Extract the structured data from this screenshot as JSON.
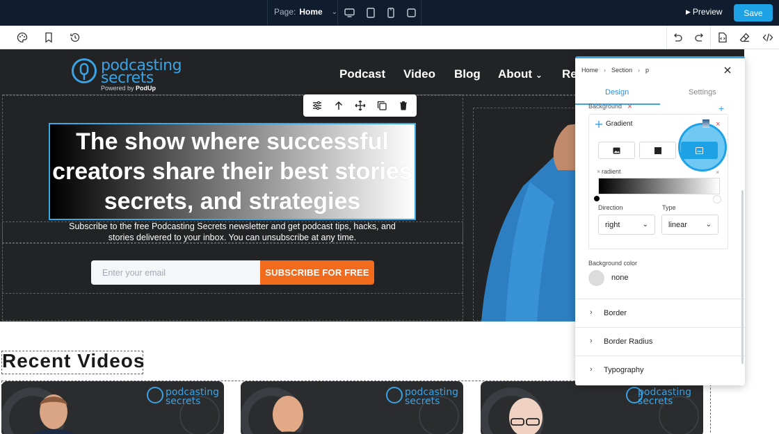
{
  "topbar": {
    "page_label": "Page:",
    "page_name": "Home",
    "preview_label": "Preview",
    "save_label": "Save",
    "colors": {
      "background": "#0f1d2e",
      "save": "#1ea2e6"
    }
  },
  "hero": {
    "logo": {
      "brand_line1": "podcasting",
      "brand_line2": "secrets",
      "powered_by": "Powered by",
      "powered_brand": "PodUp"
    },
    "nav": [
      "Podcast",
      "Video",
      "Blog",
      "About",
      "Re"
    ],
    "headline_line1": "The show where successful",
    "headline_line2": "creators share their best stories",
    "headline_line3": "secrets, and strategies",
    "subtext": "Subscribe to the free Podcasting Secrets newsletter and get podcast tips, hacks, and stories delivered to your inbox. You can unsubscribe at any time.",
    "email_placeholder": "Enter your email",
    "subscribe_label": "SUBSCRIBE FOR FREE",
    "colors": {
      "background": "#222324",
      "subscribe": "#f26a1b",
      "selection": "#39a9e6"
    }
  },
  "recent": {
    "heading": "Recent Videos",
    "cards": [
      {
        "brand_line1": "podcasting",
        "brand_line2": "secrets"
      },
      {
        "brand_line1": "podcasting",
        "brand_line2": "secrets"
      },
      {
        "brand_line1": "podcasting",
        "brand_line2": "secrets"
      }
    ]
  },
  "panel": {
    "breadcrumb": [
      "Home",
      "Section",
      "p"
    ],
    "tabs": {
      "design": "Design",
      "settings": "Settings"
    },
    "background_label": "Background",
    "gradient_title": "Gradient",
    "gradient_label": "radient",
    "direction_label": "Direction",
    "direction_value": "right",
    "type_label": "Type",
    "type_value": "linear",
    "background_color_label": "Background color",
    "background_color_value": "none",
    "accordions": [
      "Border",
      "Border Radius",
      "Typography"
    ],
    "colors": {
      "accent": "#3aa3e6",
      "remove": "#e24444"
    }
  }
}
